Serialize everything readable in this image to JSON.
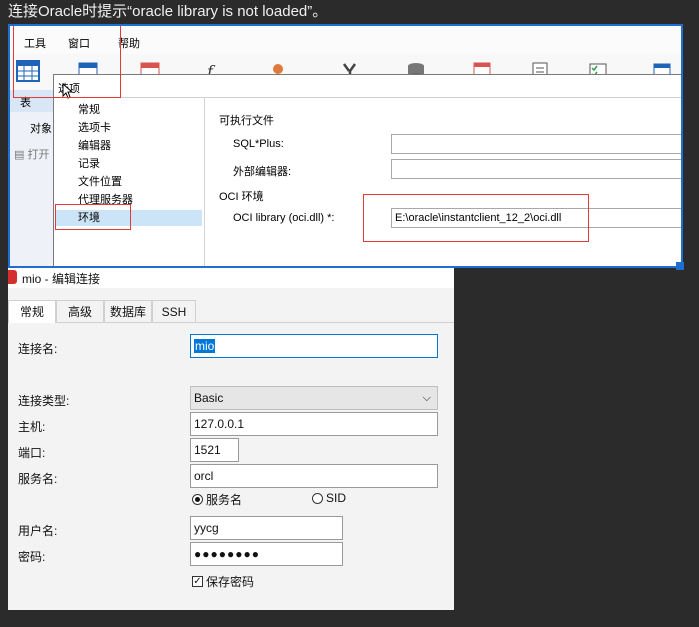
{
  "caption": "连接Oracle时提示“oracle library is not loaded”。",
  "navicat": {
    "menu": [
      "工具",
      "窗口",
      "帮助"
    ],
    "side": {
      "tab": "表",
      "objects": "对象",
      "open": "打开"
    },
    "toolbar_icons": [
      "table-icon",
      "view-icon",
      "function-icon",
      "user-icon",
      "tools-icon",
      "database-icon",
      "grid-icon",
      "report-icon",
      "checklist-icon",
      "model-icon"
    ]
  },
  "options": {
    "title": "选项",
    "nav": [
      "常规",
      "选项卡",
      "编辑器",
      "记录",
      "文件位置",
      "代理服务器",
      "环境"
    ],
    "selected_nav": "环境",
    "section_exec": "可执行文件",
    "sqlplus_label": "SQL*Plus:",
    "sqlplus_value": "",
    "external_editor_label": "外部编辑器:",
    "external_editor_value": "",
    "section_oci": "OCI 环境",
    "oci_label": "OCI library (oci.dll) *:",
    "oci_value": "E:\\oracle\\instantclient_12_2\\oci.dll"
  },
  "connection": {
    "title": "mio - 编辑连接",
    "tabs": [
      "常规",
      "高级",
      "数据库",
      "SSH"
    ],
    "name_label": "连接名:",
    "name_value": "mio",
    "type_label": "连接类型:",
    "type_value": "Basic",
    "host_label": "主机:",
    "host_value": "127.0.0.1",
    "port_label": "端口:",
    "port_value": "1521",
    "service_label": "服务名:",
    "service_value": "orcl",
    "radio_service": "服务名",
    "radio_sid": "SID",
    "radio_selected": "服务名",
    "user_label": "用户名:",
    "user_value": "yycg",
    "password_label": "密码:",
    "password_value": "●●●●●●●●",
    "save_password_label": "保存密码",
    "save_password_checked": true
  },
  "colors": {
    "accent": "#0078d7",
    "highlight_box": "#e53935",
    "frame": "#1e6fd0",
    "selection": "#cce4f7"
  }
}
